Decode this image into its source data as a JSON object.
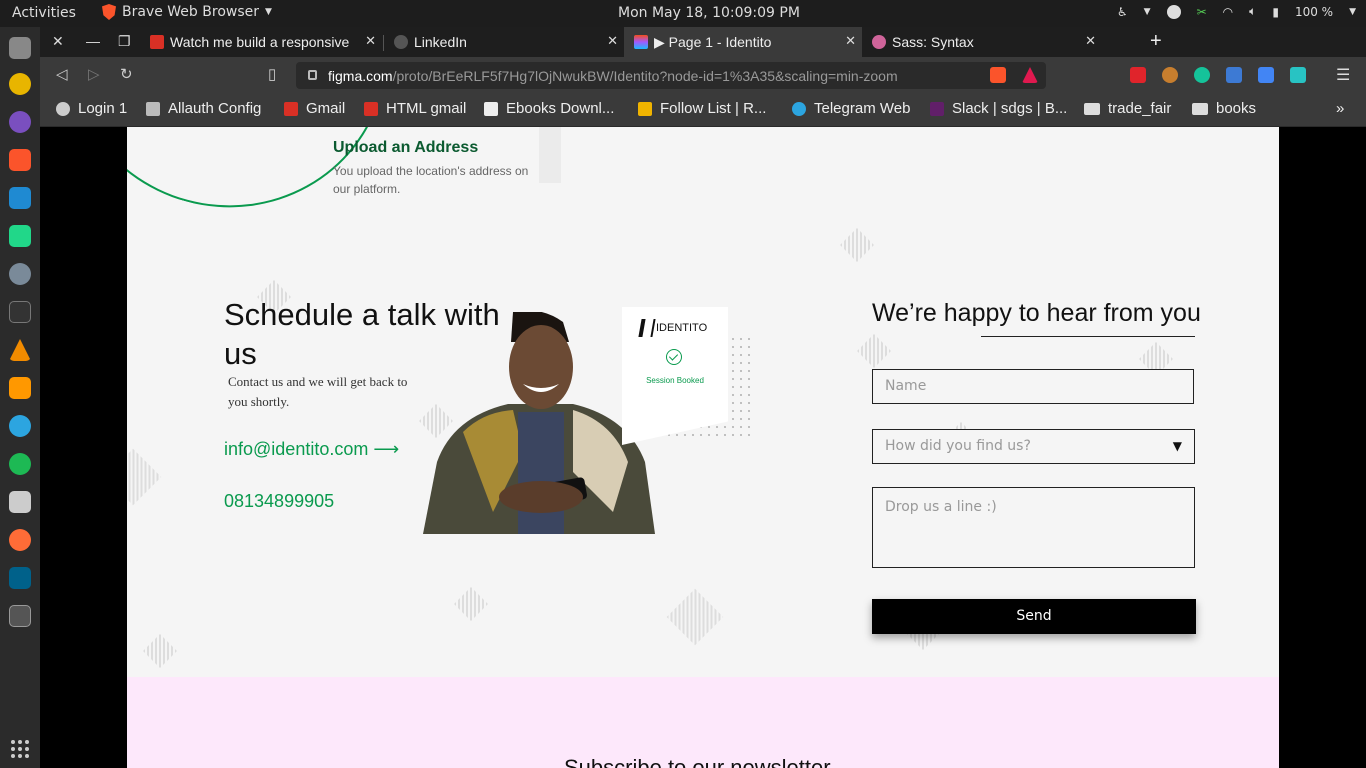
{
  "topbar": {
    "activities": "Activities",
    "app_name": "Brave Web Browser",
    "clock": "Mon May 18, 10:09:09 PM",
    "battery": "100 %"
  },
  "tabs": [
    {
      "label": "Watch me build a responsive",
      "favicon_color": "#d93025",
      "active": false
    },
    {
      "label": "LinkedIn",
      "favicon_color": "#555555",
      "active": false
    },
    {
      "label": "▶ Page 1 - Identito",
      "favicon_color": "#a259ff",
      "active": true
    },
    {
      "label": "Sass: Syntax",
      "favicon_color": "#cf649a",
      "active": false
    }
  ],
  "address_bar": {
    "host": "figma.com",
    "path": "/proto/BrEeRLF5f7Hg7lOjNwukBW/Identito?node-id=1%3A35&scaling=min-zoom"
  },
  "bookmarks": [
    {
      "label": "Login 1",
      "icon": "globe-icon"
    },
    {
      "label": "Allauth Config",
      "icon": "building-icon"
    },
    {
      "label": "Gmail",
      "icon": "gmail-icon"
    },
    {
      "label": "HTML gmail",
      "icon": "gmail-icon"
    },
    {
      "label": "Ebooks Downl...",
      "icon": "book-icon"
    },
    {
      "label": "Follow List | R...",
      "icon": "follow-icon"
    },
    {
      "label": "Telegram Web",
      "icon": "telegram-icon"
    },
    {
      "label": "Slack | sdgs | B...",
      "icon": "slack-icon"
    },
    {
      "label": "trade_fair",
      "icon": "folder-icon"
    },
    {
      "label": "books",
      "icon": "folder-icon"
    }
  ],
  "page": {
    "upload": {
      "title": "Upload an Address",
      "description": "You upload the location's address on our platform."
    },
    "schedule": {
      "title": "Schedule a talk with us",
      "description": "Contact us and we will get back to you shortly.",
      "email": "info@identito.com",
      "email_arrow": "⟶",
      "phone": "08134899905"
    },
    "card": {
      "brand": "IDENTITO",
      "status": "Session Booked"
    },
    "form": {
      "heading": "We’re happy to hear from you",
      "name_placeholder": "Name",
      "source_placeholder": "How did you find us?",
      "message_placeholder": "Drop us a line :)",
      "send_label": "Send"
    },
    "newsletter": {
      "title": "Subscribe to our newsletter"
    }
  },
  "colors": {
    "accent_green": "#0a9a4e",
    "frame_bg": "#f5f5f5",
    "newsletter_bg": "#fde8fb"
  }
}
